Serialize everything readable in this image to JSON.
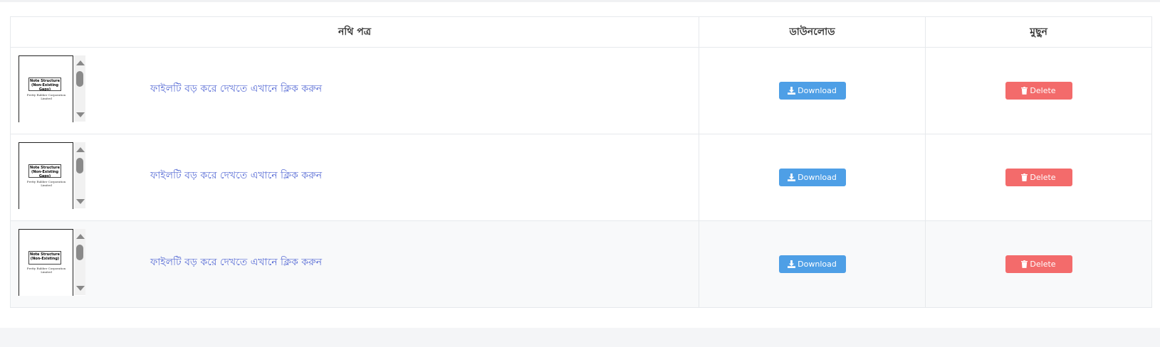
{
  "table": {
    "headers": {
      "document": "নথি পত্র",
      "download": "ডাউনলোড",
      "delete": "মুছুন"
    },
    "rows": [
      {
        "thumbnail_title": "Note Structure (Non-Existing Gaps)",
        "thumbnail_subtitle": "Pretty Rubber Corporation Limited",
        "link_text": "ফাইলটি বড় করে দেখতে এখানে ক্লিক করুন",
        "download_label": "Download",
        "delete_label": "Delete"
      },
      {
        "thumbnail_title": "Note Structure (Non-Existing Gaps)",
        "thumbnail_subtitle": "Pretty Rubber Corporation Limited",
        "link_text": "ফাইলটি বড় করে দেখতে এখানে ক্লিক করুন",
        "download_label": "Download",
        "delete_label": "Delete"
      },
      {
        "thumbnail_title": "Note Structure (Non-Existing)",
        "thumbnail_subtitle": "Pretty Rubber Corporation Limited",
        "link_text": "ফাইলটি বড় করে দেখতে এখানে ক্লিক করুন",
        "download_label": "Download",
        "delete_label": "Delete"
      }
    ]
  },
  "icons": {
    "download": "download-icon",
    "delete": "trash-icon"
  },
  "colors": {
    "download_button": "#4e9fe6",
    "delete_button": "#f36b6b",
    "link": "#5b6fd6",
    "alt_row": "#f8f9fa"
  }
}
